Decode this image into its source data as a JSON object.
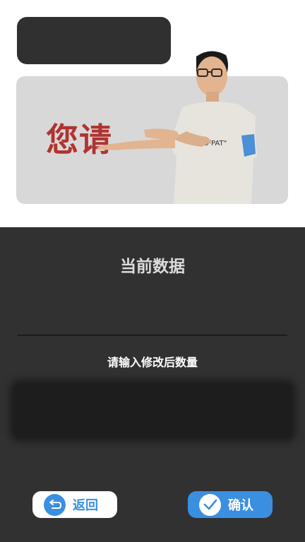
{
  "banner": {
    "text": "您请"
  },
  "panel": {
    "title": "当前数据",
    "prompt": "请输入修改后数量",
    "input_value": ""
  },
  "buttons": {
    "back_label": "返回",
    "confirm_label": "确认"
  },
  "icons": {
    "back": "return-arrow-icon",
    "confirm": "checkmark-icon"
  },
  "colors": {
    "accent": "#3a8fe0",
    "panel_bg": "#313131",
    "banner_text": "#b0332f"
  }
}
